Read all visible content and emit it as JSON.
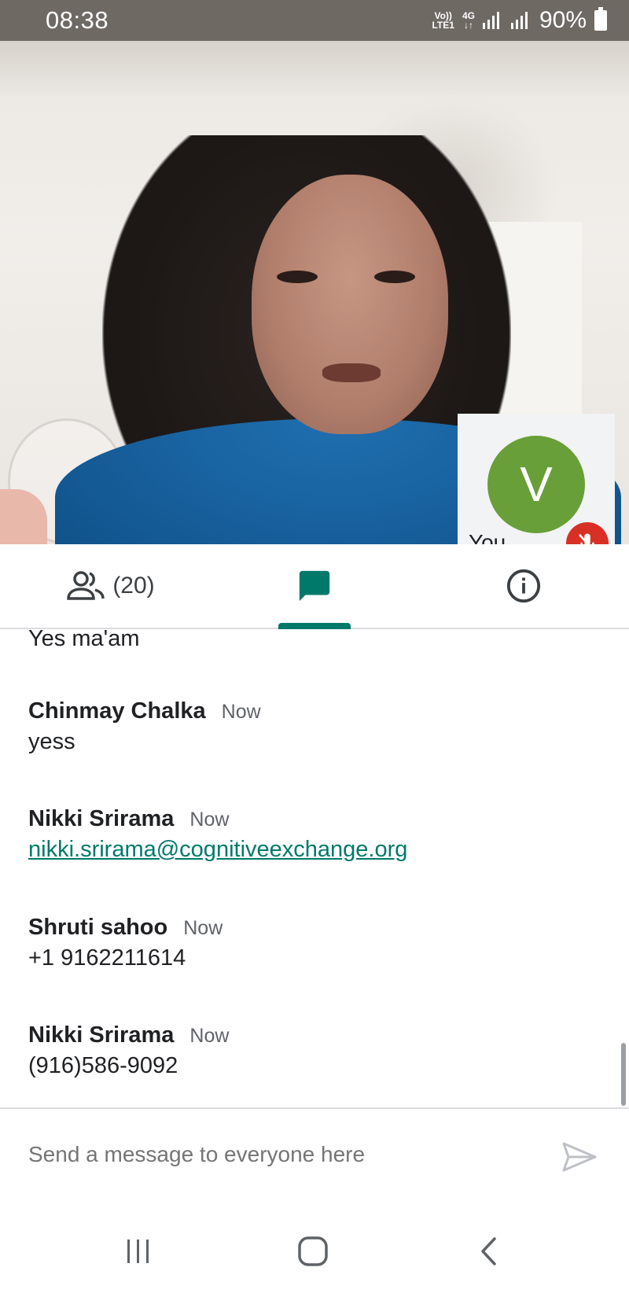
{
  "status_bar": {
    "time": "08:38",
    "volte": "Vo))\nLTE1",
    "network": "4G",
    "battery": "90%"
  },
  "video": {
    "self_initial": "V",
    "self_label": "You",
    "self_avatar_color": "#689f38",
    "mute_color": "#d93025"
  },
  "tabs": {
    "people_count": "(20)",
    "accent": "#00796b"
  },
  "messages": [
    {
      "sender": "",
      "time": "",
      "body": "Yes ma'am"
    },
    {
      "sender": "Chinmay Chalka",
      "time": "Now",
      "body": "yess"
    },
    {
      "sender": "Nikki Srirama",
      "time": "Now",
      "body": "nikki.srirama@cognitiveexchange.org",
      "is_link": true
    },
    {
      "sender": "Shruti sahoo",
      "time": "Now",
      "body": "+1 9162211614"
    },
    {
      "sender": "Nikki Srirama",
      "time": "Now",
      "body": "(916)586-9092"
    }
  ],
  "composer": {
    "placeholder": "Send a message to everyone here"
  }
}
